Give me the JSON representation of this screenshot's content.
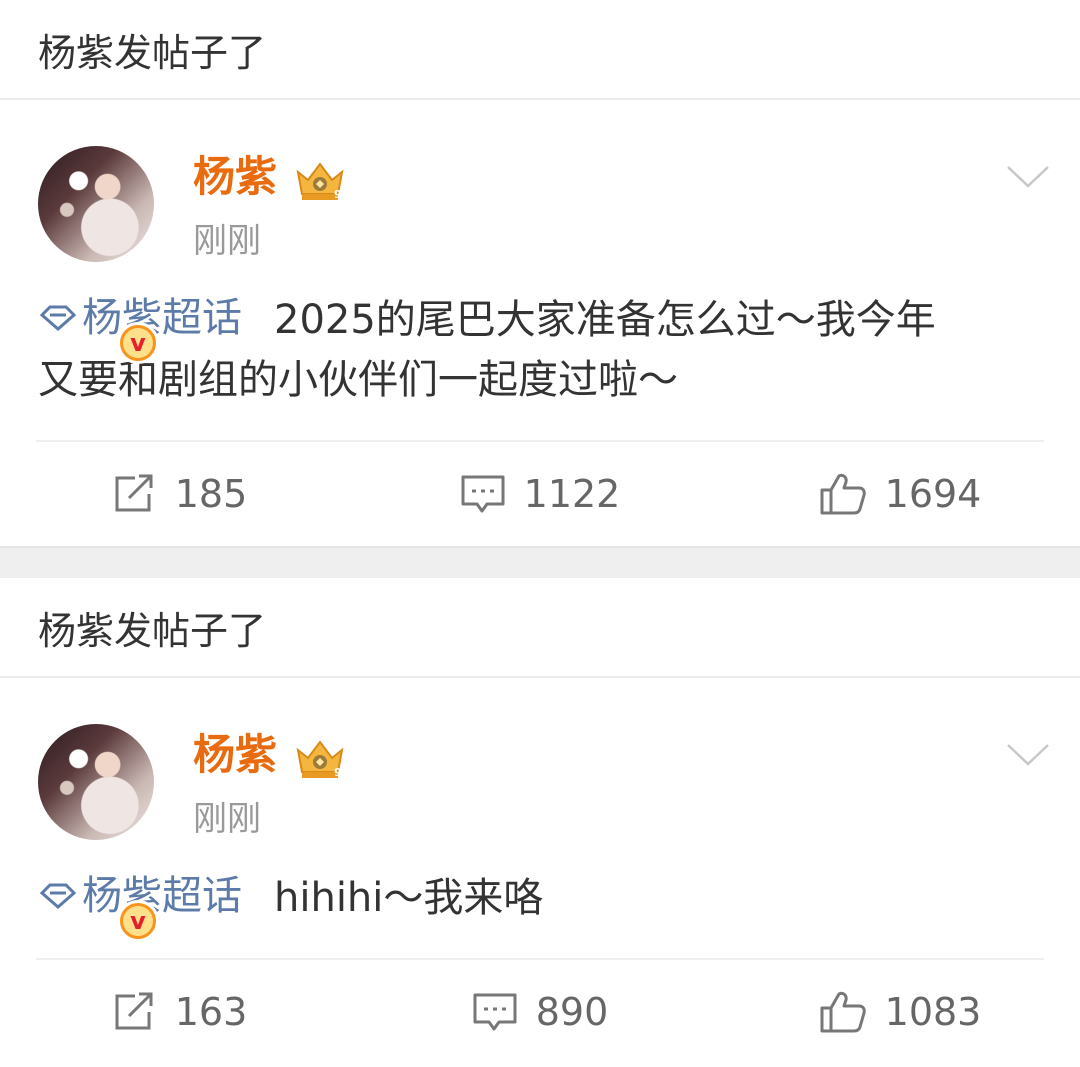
{
  "posts": [
    {
      "header": "杨紫发帖子了",
      "author": "杨紫",
      "time": "刚刚",
      "topic": "杨紫超话",
      "text_lines": [
        "2025的尾巴大家准备怎么过～我今年",
        "又要和剧组的小伙伴们一起度过啦～"
      ],
      "verified_badge": "v",
      "repost_count": "185",
      "comment_count": "1122",
      "like_count": "1694"
    },
    {
      "header": "杨紫发帖子了",
      "author": "杨紫",
      "time": "刚刚",
      "topic": "杨紫超话",
      "text_lines": [
        "hihihi～我来咯"
      ],
      "verified_badge": "v",
      "repost_count": "163",
      "comment_count": "890",
      "like_count": "1083"
    }
  ],
  "colors": {
    "author": "#e86b0f",
    "topic": "#5d7ba9",
    "text": "#333333",
    "muted": "#999999"
  },
  "icons": {
    "repost": "repost-icon",
    "comment": "comment-icon",
    "like": "like-icon",
    "more": "chevron-down-icon",
    "crown": "crown-icon",
    "topic": "diamond-icon"
  }
}
